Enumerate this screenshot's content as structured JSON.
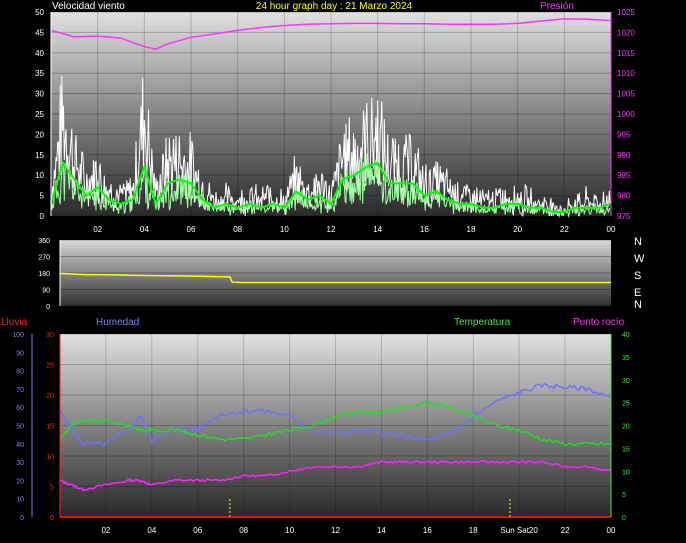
{
  "header": {
    "wind_label": "Velocidad viento",
    "title": "24 hour graph day : 21 Marzo 2024",
    "pressure_label": "Presión"
  },
  "bottom_header": {
    "rain_label": "Lluvia",
    "humidity_label": "Humedad",
    "temperature_label": "Temperatura",
    "dewpoint_label": "Punto rocío"
  },
  "direction_labels": [
    "N",
    "W",
    "S",
    "E",
    "N"
  ],
  "colors": {
    "wind_gust": "#ffffff",
    "wind_avg": "#00ff00",
    "wind_avg_light": "#a0ffa0",
    "pressure": "#ff33ff",
    "direction": "#ffff00",
    "humidity": "#7070ff",
    "temperature": "#22dd22",
    "dewpoint": "#ff22ff",
    "rain": "#ff0000",
    "rain_label": "#ff2222",
    "axis_white": "#ffffff",
    "humidity_axis": "#8080ff",
    "temp_axis": "#33ee33",
    "marker": "#ffff00",
    "title": "#ffff00"
  },
  "chart_data": [
    {
      "type": "line",
      "name": "wind-pressure",
      "x_ticks": [
        "02",
        "04",
        "06",
        "08",
        "10",
        "12",
        "14",
        "16",
        "18",
        "20",
        "22",
        "00"
      ],
      "y_left_ticks": [
        "0",
        "5",
        "10",
        "15",
        "20",
        "25",
        "30",
        "35",
        "40",
        "45",
        "50"
      ],
      "y_right_ticks": [
        "975",
        "980",
        "985",
        "990",
        "995",
        "1000",
        "1005",
        "1010",
        "1015",
        "1020",
        "1025"
      ],
      "ylim_left": [
        0,
        50
      ],
      "ylim_right": [
        975,
        1025
      ],
      "series": [
        {
          "name": "Velocidad viento",
          "style": "gust",
          "x": [
            0,
            0.5,
            1,
            1.5,
            2,
            2.5,
            3,
            3.5,
            4,
            4.5,
            5,
            5.5,
            6,
            6.5,
            7,
            7.5,
            8,
            8.5,
            9,
            9.5,
            10,
            10.5,
            11,
            11.5,
            12,
            12.5,
            13,
            13.5,
            14,
            14.5,
            15,
            15.5,
            16,
            16.5,
            17,
            17.5,
            18,
            18.5,
            19,
            19.5,
            20,
            20.5,
            21,
            21.5,
            22,
            22.5,
            23,
            23.5,
            24
          ],
          "values": [
            7,
            31,
            18,
            10,
            14,
            8,
            6,
            8,
            33,
            7,
            17,
            18,
            16,
            9,
            5,
            6,
            5,
            6,
            5,
            7,
            4,
            12,
            8,
            10,
            6,
            19,
            20,
            24,
            26,
            16,
            17,
            16,
            10,
            11,
            9,
            7,
            6,
            5,
            5,
            6,
            6,
            5,
            4,
            3,
            2,
            4,
            5,
            4,
            6
          ]
        },
        {
          "name": "",
          "style": "avg",
          "x": [
            0,
            0.5,
            1,
            1.5,
            2,
            2.5,
            3,
            3.5,
            4,
            4.5,
            5,
            5.5,
            6,
            6.5,
            7,
            7.5,
            8,
            8.5,
            9,
            9.5,
            10,
            10.5,
            11,
            11.5,
            12,
            12.5,
            13,
            13.5,
            14,
            14.5,
            15,
            15.5,
            16,
            16.5,
            17,
            17.5,
            18,
            18.5,
            19,
            19.5,
            20,
            20.5,
            21,
            21.5,
            22,
            22.5,
            23,
            23.5,
            24
          ],
          "values": [
            3,
            13,
            9,
            5,
            7,
            4,
            3,
            4,
            12,
            3,
            8,
            9,
            8,
            4,
            2,
            3,
            2,
            3,
            2,
            3,
            2,
            6,
            4,
            5,
            3,
            9,
            10,
            12,
            13,
            8,
            8,
            8,
            5,
            6,
            4,
            3,
            3,
            2,
            2,
            3,
            3,
            2,
            2,
            1,
            1,
            2,
            2,
            2,
            3
          ]
        },
        {
          "name": "Presión",
          "axis": "right",
          "x": [
            0,
            1,
            2,
            3,
            4,
            4.5,
            5,
            6,
            7,
            8,
            9,
            10,
            11,
            12,
            13,
            14,
            15,
            16,
            17,
            18,
            19,
            20,
            21,
            22,
            23,
            24
          ],
          "values": [
            1020.5,
            1018.9,
            1019.1,
            1018.6,
            1016.5,
            1015.9,
            1017.2,
            1018.8,
            1019.6,
            1020.5,
            1021.2,
            1021.7,
            1022.0,
            1022.1,
            1022.2,
            1022.2,
            1022.1,
            1022.1,
            1022.0,
            1022.0,
            1022.0,
            1022.2,
            1022.8,
            1023.3,
            1023.2,
            1022.9
          ]
        }
      ]
    },
    {
      "type": "line",
      "name": "wind-direction",
      "y_ticks": [
        "0",
        "90",
        "180",
        "270",
        "360"
      ],
      "ylim": [
        0,
        360
      ],
      "series": [
        {
          "name": "",
          "x": [
            0,
            1,
            2,
            3,
            4,
            5,
            6,
            7,
            7.4,
            7.5,
            8,
            10,
            12,
            14,
            16,
            18,
            20,
            22,
            24
          ],
          "values": [
            178,
            172,
            170,
            168,
            166,
            164,
            162,
            160,
            158,
            130,
            128,
            128,
            128,
            128,
            128,
            128,
            128,
            128,
            128
          ]
        }
      ]
    },
    {
      "type": "line",
      "name": "humidity-temperature",
      "x_ticks": [
        "02",
        "04",
        "06",
        "08",
        "10",
        "12",
        "14",
        "16",
        "18",
        "Sun Sat20",
        "22",
        "00"
      ],
      "y_rain_ticks": [
        "0",
        "5",
        "10",
        "15",
        "20",
        "25",
        "30"
      ],
      "y_humidity_ticks": [
        "0",
        "10",
        "20",
        "30",
        "40",
        "50",
        "60",
        "70",
        "80",
        "90",
        "100"
      ],
      "y_temp_ticks": [
        "0",
        "5",
        "10",
        "15",
        "20",
        "25",
        "30",
        "35",
        "40"
      ],
      "ylim_humidity": [
        0,
        100
      ],
      "ylim_temperature": [
        0,
        40
      ],
      "ylim_rain": [
        0,
        30
      ],
      "series": [
        {
          "name": "Humedad",
          "axis": "humidity",
          "x": [
            0,
            0.5,
            1,
            2,
            3,
            3.5,
            4,
            5,
            6,
            7,
            8,
            9,
            10,
            11,
            12,
            13,
            14,
            15,
            16,
            17,
            18,
            19,
            20,
            21,
            22,
            23,
            24
          ],
          "values": [
            58,
            48,
            40,
            40,
            48,
            55,
            42,
            48,
            48,
            56,
            58,
            58,
            55,
            47,
            46,
            47,
            46,
            44,
            42,
            45,
            55,
            63,
            68,
            72,
            71,
            70,
            65
          ]
        },
        {
          "name": "Temperatura",
          "axis": "temperature",
          "x": [
            0,
            0.5,
            1,
            2,
            3,
            3.5,
            4,
            5,
            6,
            7,
            8,
            9,
            10,
            11,
            12,
            13,
            14,
            15,
            16,
            17,
            18,
            19,
            20,
            21,
            22,
            23,
            24
          ],
          "values": [
            17,
            20,
            21,
            21,
            20,
            19,
            19,
            19,
            18,
            17,
            17,
            18,
            19,
            20,
            22,
            23,
            23,
            24,
            25,
            24,
            22,
            20,
            19,
            17,
            16,
            16,
            16
          ]
        },
        {
          "name": "Punto rocío",
          "axis": "temperature",
          "x": [
            0,
            0.5,
            1,
            2,
            3,
            3.5,
            4,
            5,
            6,
            7,
            8,
            9,
            10,
            11,
            12,
            13,
            14,
            15,
            16,
            17,
            18,
            19,
            20,
            21,
            22,
            23,
            24
          ],
          "values": [
            8,
            7,
            6,
            7,
            8,
            8,
            7,
            8,
            8,
            8,
            9,
            9,
            10,
            11,
            11,
            11,
            12,
            12,
            12,
            12,
            12,
            12,
            12,
            12,
            11,
            11,
            10
          ]
        },
        {
          "name": "Lluvia",
          "axis": "rain",
          "x": [
            0,
            24
          ],
          "values": [
            0,
            0
          ]
        }
      ],
      "markers": [
        7.4,
        19.6
      ]
    }
  ]
}
